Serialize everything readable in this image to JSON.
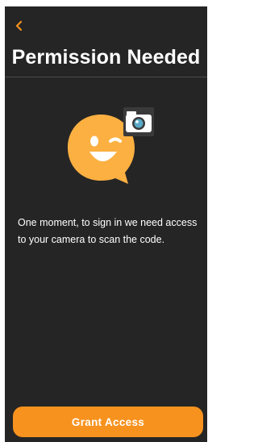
{
  "header": {
    "back_icon": "chevron-left-icon",
    "title": "Permission Needed"
  },
  "main": {
    "illustration_icons": [
      "winking-chat-bubble-icon",
      "camera-icon"
    ],
    "message": "One moment, to sign in we need access to your camera to scan the code."
  },
  "footer": {
    "grant_label": "Grant Access"
  },
  "colors": {
    "background": "#252525",
    "accent": "#f7921e",
    "bubble": "#fbb041",
    "text": "#ffffff"
  }
}
